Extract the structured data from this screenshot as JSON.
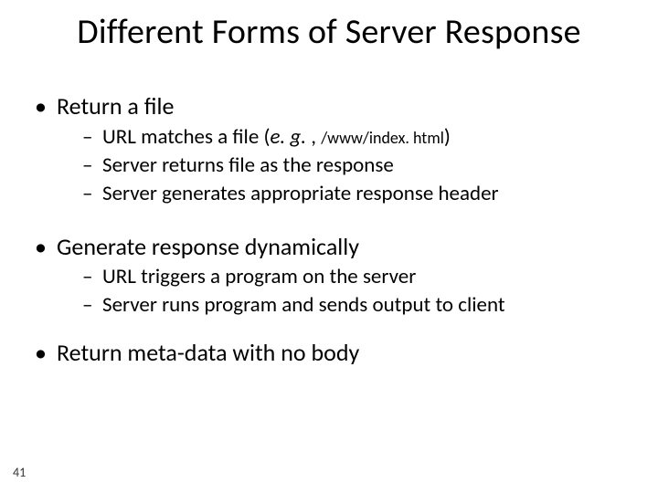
{
  "title": "Different Forms of Server Response",
  "bullets": {
    "b1": {
      "text": "Return a file",
      "subs": {
        "s1a": "URL matches a file (",
        "s1b_em": "e. g. ",
        "s1c": ", ",
        "s1d_fine": "/www/index. html",
        "s1e": ")",
        "s2": "Server returns file as the response",
        "s3": "Server generates appropriate response header"
      }
    },
    "b2": {
      "text": "Generate response dynamically",
      "subs": {
        "s1": "URL triggers a program on the server",
        "s2": "Server runs program and sends output to client"
      }
    },
    "b3": {
      "text": "Return meta-data with no body"
    }
  },
  "slide_number": "41"
}
